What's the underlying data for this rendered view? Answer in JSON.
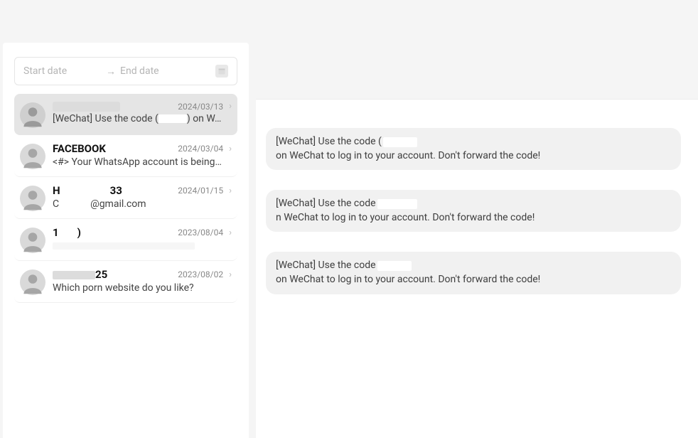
{
  "dateRange": {
    "startPlaceholder": "Start date",
    "endPlaceholder": "End date"
  },
  "conversations": [
    {
      "titleRedacted": true,
      "date": "2024/03/13",
      "previewPrefix": "[WeChat] Use the code (",
      "previewSuffix": ") on W…",
      "selected": true
    },
    {
      "title": "FACEBOOK",
      "date": "2024/03/04",
      "preview": "<#> Your WhatsApp account is being r…"
    },
    {
      "titleCompositePrefix": "H",
      "titleCompositeSuffix": "33",
      "date": "2024/01/15",
      "previewCompositePrefix": "C",
      "previewCompositeSuffix": "@gmail.com"
    },
    {
      "titleCompositePrefix": "1",
      "titleCompositeSuffix": ")",
      "date": "2023/08/04",
      "previewRedactedLine": true
    },
    {
      "titleCompositePrefix": "",
      "titleCompositeSuffix": "25",
      "date": "2023/08/02",
      "preview": "Which porn website do you like?"
    }
  ],
  "messages": [
    {
      "prefix": "[WeChat] Use the code (",
      "suffix": " on WeChat to log in to your account. Don't forward the code!"
    },
    {
      "prefix": "[WeChat] Use the code ",
      "suffix": "n WeChat to log in to your account. Don't forward the code!"
    },
    {
      "prefix": "[WeChat] Use the code ",
      "suffix": " on WeChat to log in to your account. Don't forward the code!"
    }
  ]
}
